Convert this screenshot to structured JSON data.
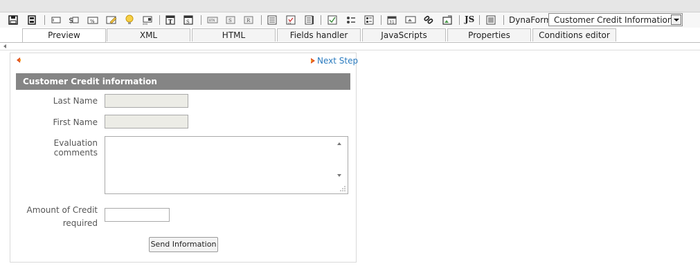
{
  "toolbar": {
    "icons": [
      "save-icon",
      "save-as-icon",
      "textbox-icon",
      "currency-icon",
      "percentage-icon",
      "textarea-icon",
      "suggest-icon",
      "dropdown-icon",
      "title-icon",
      "subtitle-icon",
      "button-icon",
      "submit-icon",
      "reset-icon",
      "listbox-icon",
      "checkgroup-icon",
      "radiogroup-icon",
      "checkbox-icon",
      "yesno-icon",
      "grid-icon",
      "date-icon",
      "file-icon",
      "link-icon",
      "image-icon",
      "javascript-icon",
      "hidden-icon"
    ],
    "js_label": "JS",
    "dynaform_label": "DynaForm:",
    "dynaform_value": "Customer Credit Information"
  },
  "tabs": [
    {
      "label": "Preview"
    },
    {
      "label": "XML"
    },
    {
      "label": "HTML"
    },
    {
      "label": "Fields handler"
    },
    {
      "label": "JavaScripts"
    },
    {
      "label": "Properties"
    },
    {
      "label": "Conditions editor"
    }
  ],
  "form": {
    "next_step": "Next Step",
    "title": "Customer Credit information",
    "fields": {
      "last_name": {
        "label": "Last Name",
        "value": ""
      },
      "first_name": {
        "label": "First Name",
        "value": ""
      },
      "evaluation": {
        "label": "Evaluation comments",
        "value": ""
      },
      "amount_line1": "Amount of Credit",
      "amount_line2": "required",
      "amount_value": ""
    },
    "submit_label": "Send Information"
  }
}
